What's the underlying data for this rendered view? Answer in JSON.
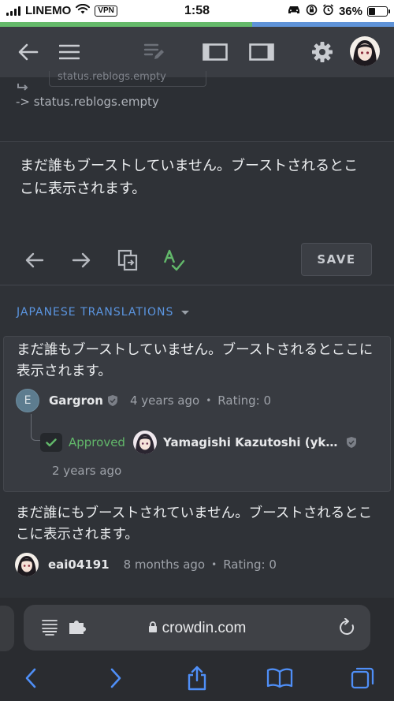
{
  "status_bar": {
    "carrier": "LINEMO",
    "vpn": "VPN",
    "time": "1:58",
    "battery": "36%",
    "battery_level": 0.36
  },
  "page_progress": 0.64,
  "toolbar": {
    "icons": [
      "back-arrow-icon",
      "menu-icon",
      "edit-notes-icon",
      "left-panel-icon",
      "right-panel-icon",
      "gear-icon",
      "user-avatar"
    ]
  },
  "source": {
    "key_chip": "status.reblogs.empty",
    "key_text": "-> status.reblogs.empty"
  },
  "editor": {
    "text": "まだ誰もブーストしていません。ブーストされるとここに表示されます。",
    "save_label": "SAVE"
  },
  "translations": {
    "header": "JAPANESE TRANSLATIONS",
    "items": [
      {
        "text": "まだ誰もブーストしていません。ブーストされるとここに表示されます。",
        "avatar_letter": "E",
        "author": "Gargron",
        "time": "4 years ago",
        "rating": "Rating: 0",
        "approval": {
          "status": "Approved",
          "approver": "Yamagishi Kazutoshi (yk…",
          "time": "2 years ago"
        }
      },
      {
        "text": "まだ誰にもブーストされていません。ブーストされるとここに表示されます。",
        "author": "eai04191",
        "time": "8 months ago",
        "rating": "Rating: 0"
      }
    ]
  },
  "browser": {
    "url": "crowdin.com"
  },
  "colors": {
    "accent_blue": "#5b95e0",
    "approved_green": "#62b86a",
    "progress_green": "#65b96a",
    "progress_blue": "#5f93d8"
  }
}
